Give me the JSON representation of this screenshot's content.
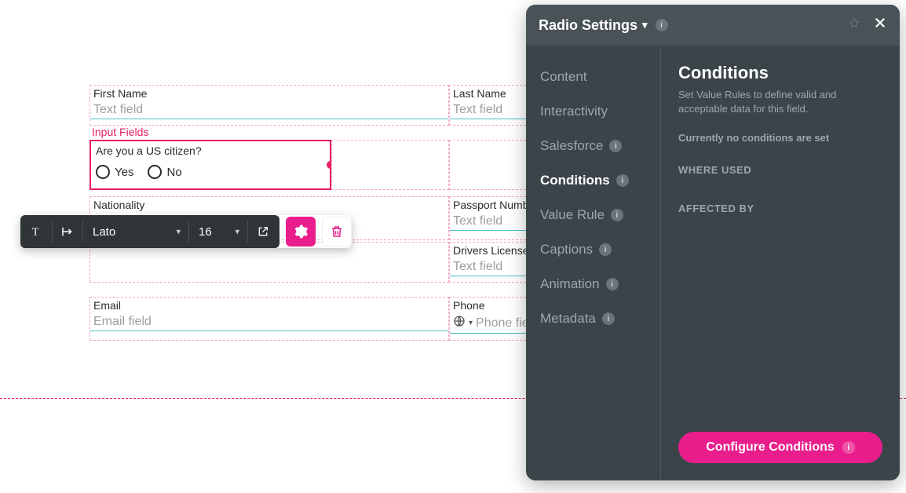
{
  "section_label": "Input Fields",
  "fields": {
    "first_name": {
      "label": "First Name",
      "placeholder": "Text field"
    },
    "last_name": {
      "label": "Last Name",
      "placeholder": "Text field"
    },
    "nationality": {
      "label": "Nationality"
    },
    "passport": {
      "label": "Passport Number",
      "placeholder": "Text field"
    },
    "drivers": {
      "label": "Drivers License Number",
      "placeholder": "Text field"
    },
    "email": {
      "label": "Email",
      "placeholder": "Email field"
    },
    "phone": {
      "label": "Phone",
      "placeholder": "Phone field"
    }
  },
  "radio": {
    "question": "Are you a US citizen?",
    "options": [
      "Yes",
      "No"
    ]
  },
  "toolbar": {
    "font": "Lato",
    "size": "16"
  },
  "panel": {
    "title": "Radio Settings",
    "nav": {
      "content": "Content",
      "interactivity": "Interactivity",
      "salesforce": "Salesforce",
      "conditions": "Conditions",
      "value_rule": "Value Rule",
      "captions": "Captions",
      "animation": "Animation",
      "metadata": "Metadata"
    },
    "content": {
      "title": "Conditions",
      "subtitle": "Set Value Rules to define valid and acceptable data for this field.",
      "status": "Currently no conditions are set",
      "where_used": "WHERE USED",
      "affected_by": "AFFECTED BY",
      "configure_btn": "Configure Conditions"
    }
  }
}
